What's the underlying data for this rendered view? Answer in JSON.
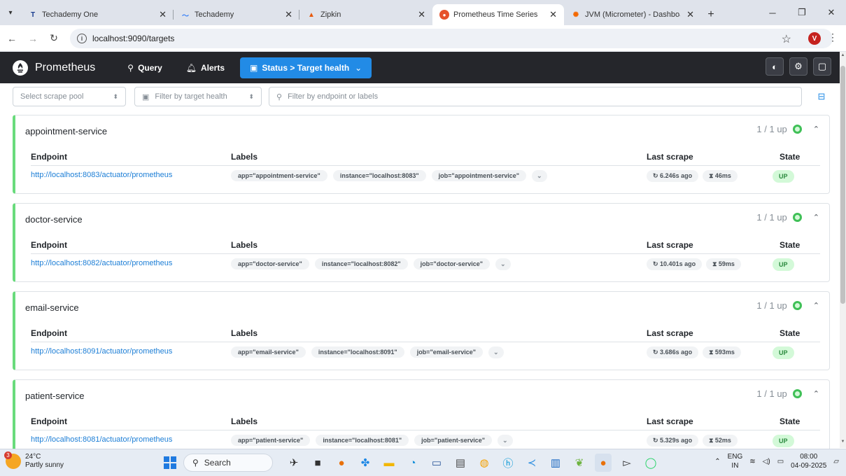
{
  "browser": {
    "tabs": [
      {
        "label": "Techademy One",
        "icon": "techademy-icon",
        "width": 228,
        "active": false
      },
      {
        "label": "Techademy",
        "icon": "techademy-wave-icon",
        "width": 178,
        "active": false
      },
      {
        "label": "Zipkin",
        "icon": "zipkin-icon",
        "width": 188,
        "active": false
      },
      {
        "label": "Prometheus Time Series Collect",
        "icon": "prometheus-icon",
        "width": 186,
        "active": true
      },
      {
        "label": "JVM (Micrometer) - Dashboard",
        "icon": "grafana-icon",
        "width": 200,
        "active": false
      }
    ],
    "url": "localhost:9090/targets",
    "profile_initial": "V"
  },
  "prometheus": {
    "brand": "Prometheus",
    "nav": {
      "query": "Query",
      "alerts": "Alerts",
      "status": "Status > Target health"
    },
    "filters": {
      "scrape_pool": "Select scrape pool",
      "health": "Filter by target health",
      "search": "Filter by endpoint or labels"
    },
    "table_headers": {
      "endpoint": "Endpoint",
      "labels": "Labels",
      "last_scrape": "Last scrape",
      "state": "State"
    },
    "pools": [
      {
        "name": "appointment-service",
        "status": "1 / 1 up",
        "endpoint": "http://localhost:8083/actuator/prometheus",
        "labels": [
          "app=\"appointment-service\"",
          "instance=\"localhost:8083\"",
          "job=\"appointment-service\""
        ],
        "last_scrape": "6.246s ago",
        "duration": "46ms",
        "state": "UP"
      },
      {
        "name": "doctor-service",
        "status": "1 / 1 up",
        "endpoint": "http://localhost:8082/actuator/prometheus",
        "labels": [
          "app=\"doctor-service\"",
          "instance=\"localhost:8082\"",
          "job=\"doctor-service\""
        ],
        "last_scrape": "10.401s ago",
        "duration": "59ms",
        "state": "UP"
      },
      {
        "name": "email-service",
        "status": "1 / 1 up",
        "endpoint": "http://localhost:8091/actuator/prometheus",
        "labels": [
          "app=\"email-service\"",
          "instance=\"localhost:8091\"",
          "job=\"email-service\""
        ],
        "last_scrape": "3.686s ago",
        "duration": "593ms",
        "state": "UP"
      },
      {
        "name": "patient-service",
        "status": "1 / 1 up",
        "endpoint": "http://localhost:8081/actuator/prometheus",
        "labels": [
          "app=\"patient-service\"",
          "instance=\"localhost:8081\"",
          "job=\"patient-service\""
        ],
        "last_scrape": "5.329s ago",
        "duration": "52ms",
        "state": "UP"
      }
    ]
  },
  "taskbar": {
    "weather_temp": "24°C",
    "weather_desc": "Partly sunny",
    "weather_badge": "3",
    "search": "Search",
    "lang_top": "ENG",
    "lang_bottom": "IN",
    "time": "08:00",
    "date": "04-09-2025"
  },
  "colors": {
    "accent": "#228be6",
    "up_green": "#40c057",
    "nav_bg": "#25262b",
    "endpoint_link": "#1c7ed6"
  }
}
